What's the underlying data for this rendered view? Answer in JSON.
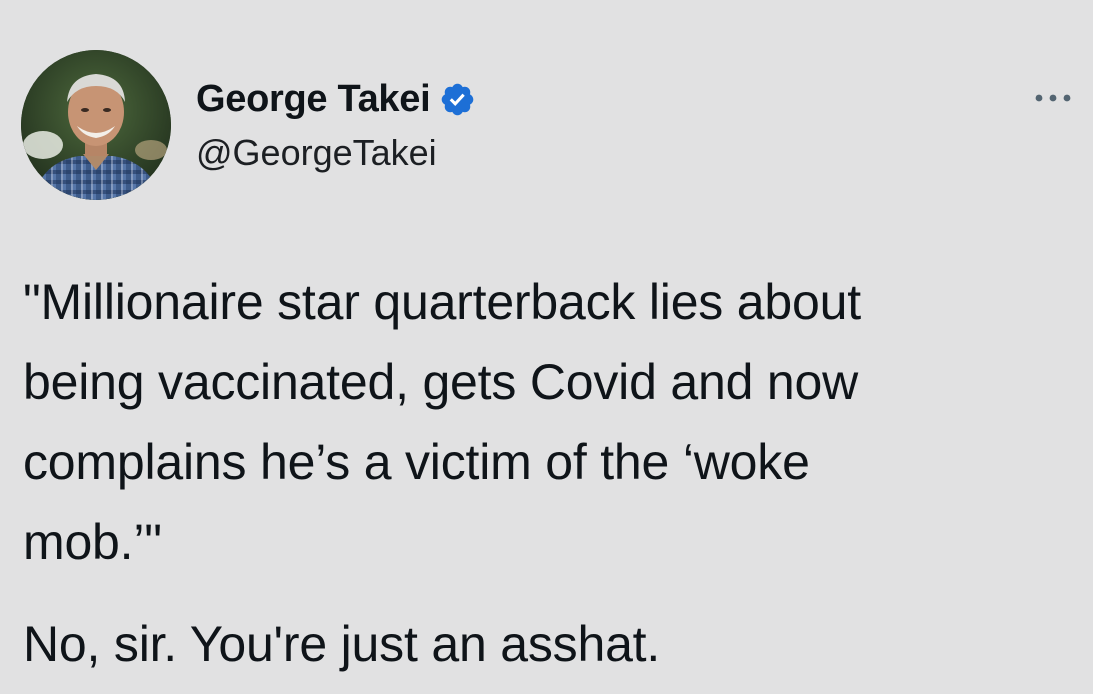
{
  "author": {
    "display_name": "George Takei",
    "handle": "@GeorgeTakei",
    "verified": true,
    "verified_color": "#1d9bf0",
    "avatar_icon": "profile-photo"
  },
  "menu": {
    "icon": "more-horizontal-icon"
  },
  "tweet": {
    "quote": "\"Millionaire star quarterback lies about\nbeing vaccinated, gets Covid and now\ncomplains he’s a victim of the ‘woke\nmob.’\"",
    "comment": "No, sir. You're just an asshat."
  },
  "theme": {
    "background": "#e1e1e2",
    "text": "#0f1419"
  }
}
